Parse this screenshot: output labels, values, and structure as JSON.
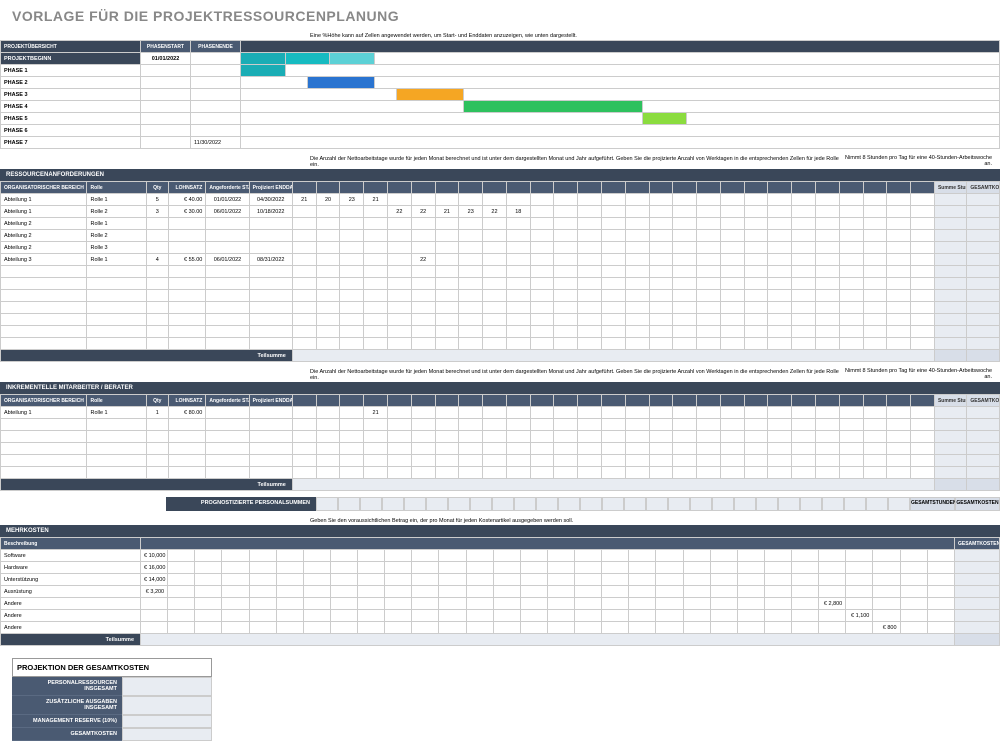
{
  "title": "VORLAGE FÜR DIE PROJEKTRESSOURCENPLANUNG",
  "notes": {
    "gantt": "Eine %Höhe kann auf Zellen angewendet werden, um Start- und Enddaten anzuzeigen, wie unten dargestellt.",
    "req1": "Die Anzahl der Nettoarbeitstage wurde für jeden Monat berechnet und ist unter dem dargestellten Monat und Jahr aufgeführt. Geben Sie die projizierte Anzahl von Werktagen in die entsprechenden Zellen für jede Rolle ein.",
    "req2": "Nimmt 8 Stunden pro Tag für eine 40-Stunden-Arbeitswoche an.",
    "cost": "Geben Sie den voraussichtlichen Betrag ein, der pro Monat für jeden Kostenartikel ausgegeben werden soll."
  },
  "overview": {
    "header": "PROJEKTÜBERSICHT",
    "col_start": "PHASENSTART",
    "col_end": "PHASENENDE",
    "begin_label": "PROJEKTBEGINN",
    "begin_date": "01/01/2022",
    "phases": [
      "PHASE 1",
      "PHASE 2",
      "PHASE 3",
      "PHASE 4",
      "PHASE 5",
      "PHASE 6",
      "PHASE 7"
    ],
    "end_date": "11/30/2022"
  },
  "req": {
    "header": "RESSOURCENANFORDERUNGEN",
    "cols": {
      "area": "ORGANISATORISCHER BEREICH",
      "role": "Rolle",
      "qty": "Qty",
      "rate": "LOHNSATZ",
      "start": "Angeforderte STARTDATUM",
      "end": "Projiziert ENDDATUM",
      "sumh": "Summe Stunden",
      "cost": "GESAMTKOSTEN Zugeordnet"
    },
    "rows": [
      {
        "area": "Abteilung 1",
        "role": "Rolle 1",
        "qty": "5",
        "rate": "€   40.00",
        "start": "01/01/2022",
        "end": "04/30/2022",
        "t": [
          "21",
          "20",
          "23",
          "21",
          "",
          "",
          "",
          "",
          "",
          "",
          "",
          "",
          "",
          "",
          "",
          "",
          "",
          "",
          "",
          "",
          "",
          "",
          "",
          "",
          "",
          "",
          ""
        ]
      },
      {
        "area": "Abteilung 1",
        "role": "Rolle 2",
        "qty": "3",
        "rate": "€   30.00",
        "start": "06/01/2022",
        "end": "10/18/2022",
        "t": [
          "",
          "",
          "",
          "",
          "22",
          "22",
          "21",
          "23",
          "22",
          "18",
          "",
          "",
          "",
          "",
          "",
          "",
          "",
          "",
          "",
          "",
          "",
          "",
          "",
          "",
          "",
          "",
          ""
        ]
      },
      {
        "area": "Abteilung 2",
        "role": "Rolle 1",
        "qty": "",
        "rate": "",
        "start": "",
        "end": "",
        "t": [
          "",
          "",
          "",
          "",
          "",
          "",
          "",
          "",
          "",
          "",
          "",
          "",
          "",
          "",
          "",
          "",
          "",
          "",
          "",
          "",
          "",
          "",
          "",
          "",
          "",
          "",
          ""
        ]
      },
      {
        "area": "Abteilung 2",
        "role": "Rolle 2",
        "qty": "",
        "rate": "",
        "start": "",
        "end": "",
        "t": [
          "",
          "",
          "",
          "",
          "",
          "",
          "",
          "",
          "",
          "",
          "",
          "",
          "",
          "",
          "",
          "",
          "",
          "",
          "",
          "",
          "",
          "",
          "",
          "",
          "",
          "",
          ""
        ]
      },
      {
        "area": "Abteilung 2",
        "role": "Rolle 3",
        "qty": "",
        "rate": "",
        "start": "",
        "end": "",
        "t": [
          "",
          "",
          "",
          "",
          "",
          "",
          "",
          "",
          "",
          "",
          "",
          "",
          "",
          "",
          "",
          "",
          "",
          "",
          "",
          "",
          "",
          "",
          "",
          "",
          "",
          "",
          ""
        ]
      },
      {
        "area": "Abteilung 3",
        "role": "Rolle 1",
        "qty": "4",
        "rate": "€   55.00",
        "start": "06/01/2022",
        "end": "08/31/2022",
        "t": [
          "",
          "",
          "",
          "",
          "",
          "22",
          "",
          "",
          "",
          "",
          "",
          "",
          "",
          "",
          "",
          "",
          "",
          "",
          "",
          "",
          "",
          "",
          "",
          "",
          "",
          "",
          ""
        ]
      }
    ],
    "subtotal": "Teilsumme"
  },
  "inc": {
    "header": "INKREMENTELLE MITARBEITER / BERATER",
    "rows": [
      {
        "area": "Abteilung 1",
        "role": "Rolle 1",
        "qty": "1",
        "rate": "€   80.00",
        "start": "",
        "end": "",
        "t": [
          "",
          "",
          "",
          "21",
          "",
          "",
          "",
          "",
          "",
          "",
          "",
          "",
          "",
          "",
          "",
          "",
          "",
          "",
          "",
          "",
          "",
          "",
          "",
          "",
          "",
          "",
          ""
        ]
      }
    ],
    "subtotal": "Teilsumme"
  },
  "forecast": {
    "label": "PROGNOSTIZIERTE PERSONALSUMMEN",
    "tot1": "GESAMTSTUNDEN",
    "tot2": "GESAMTKOSTEN"
  },
  "costs": {
    "header": "MEHRKOSTEN",
    "col_desc": "Beschreibung",
    "col_tot": "GESAMTKOSTEN",
    "rows": [
      {
        "desc": "Software",
        "amt": "€   10,000",
        "t": [
          "",
          "",
          "",
          "",
          "",
          "",
          "",
          "",
          "",
          "",
          "",
          "",
          "",
          "",
          "",
          "",
          "",
          "",
          "",
          "",
          "",
          "",
          "",
          "",
          "",
          "",
          "",
          "",
          ""
        ]
      },
      {
        "desc": "Hardware",
        "amt": "€   16,000",
        "t": [
          "",
          "",
          "",
          "",
          "",
          "",
          "",
          "",
          "",
          "",
          "",
          "",
          "",
          "",
          "",
          "",
          "",
          "",
          "",
          "",
          "",
          "",
          "",
          "",
          "",
          "",
          "",
          "",
          ""
        ]
      },
      {
        "desc": "Unterstützung",
        "amt": "€   14,000",
        "t": [
          "",
          "",
          "",
          "",
          "",
          "",
          "",
          "",
          "",
          "",
          "",
          "",
          "",
          "",
          "",
          "",
          "",
          "",
          "",
          "",
          "",
          "",
          "",
          "",
          "",
          "",
          "",
          "",
          ""
        ]
      },
      {
        "desc": "Ausrüstung",
        "amt": "€    3,200",
        "t": [
          "",
          "",
          "",
          "",
          "",
          "",
          "",
          "",
          "",
          "",
          "",
          "",
          "",
          "",
          "",
          "",
          "",
          "",
          "",
          "",
          "",
          "",
          "",
          "",
          "",
          "",
          "",
          "",
          ""
        ]
      },
      {
        "desc": "Andere",
        "amt": "",
        "t": [
          "",
          "",
          "",
          "",
          "",
          "",
          "",
          "",
          "",
          "",
          "",
          "",
          "",
          "",
          "",
          "",
          "",
          "",
          "",
          "",
          "",
          "",
          "",
          "",
          "€  2,800",
          "",
          "",
          "",
          ""
        ]
      },
      {
        "desc": "Andere",
        "amt": "",
        "t": [
          "",
          "",
          "",
          "",
          "",
          "",
          "",
          "",
          "",
          "",
          "",
          "",
          "",
          "",
          "",
          "",
          "",
          "",
          "",
          "",
          "",
          "",
          "",
          "",
          "",
          "€  1,100",
          "",
          "",
          ""
        ]
      },
      {
        "desc": "Andere",
        "amt": "",
        "t": [
          "",
          "",
          "",
          "",
          "",
          "",
          "",
          "",
          "",
          "",
          "",
          "",
          "",
          "",
          "",
          "",
          "",
          "",
          "",
          "",
          "",
          "",
          "",
          "",
          "",
          "",
          "€   800",
          "",
          ""
        ]
      }
    ],
    "subtotal": "Teilsumme"
  },
  "proj": {
    "title": "PROJEKTION DER GESAMTKOSTEN",
    "r1": "PERSONALRESSOURCEN INSGESAMT",
    "r2": "ZUSÄTZLICHE AUSGABEN INSGESAMT",
    "r3": "MANAGEMENT RESERVE (10%)",
    "r4": "GESAMTKOSTEN"
  }
}
